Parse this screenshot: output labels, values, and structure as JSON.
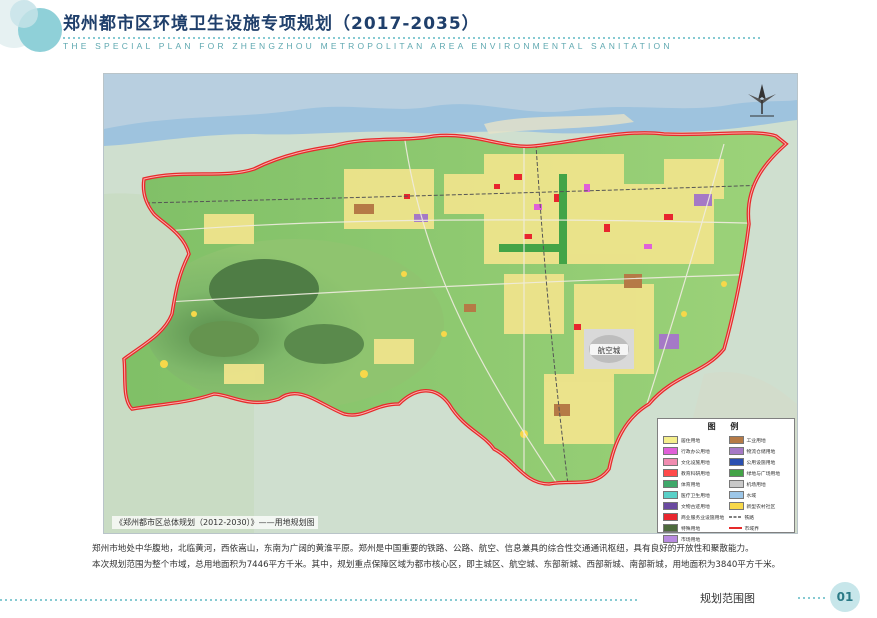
{
  "header": {
    "title": "郑州都市区环境卫生设施专项规划（2017-2035）",
    "subtitle": "THE  SPECIAL PLAN FOR ZHENGZHOU  METROPOLITAN  AREA  ENVIRONMENTAL  SANITATION",
    "accent_color": "#5fb8c4"
  },
  "map": {
    "caption": "《郑州都市区总体规划（2012-2030）》——用地规划图",
    "center_label": "航空城",
    "boundary_color": "#e62a2a",
    "river_color": "#b4d0e3",
    "base_green": "#6fb45e",
    "urban_color": "#efe48c"
  },
  "legend": {
    "title": "图 例",
    "items": [
      {
        "label": "居住用地",
        "color": "#f5ef8c"
      },
      {
        "label": "工业用地",
        "color": "#b57a46"
      },
      {
        "label": "行政办公用地",
        "color": "#e060d8"
      },
      {
        "label": "物流仓储用地",
        "color": "#a579c6"
      },
      {
        "label": "文化设施用地",
        "color": "#f08cb0"
      },
      {
        "label": "公用设施用地",
        "color": "#2a4fb0"
      },
      {
        "label": "教育科研用地",
        "color": "#ff4a4a"
      },
      {
        "label": "绿地与广场用地",
        "color": "#43a447"
      },
      {
        "label": "体育用地",
        "color": "#3fa86a"
      },
      {
        "label": "机场用地",
        "color": "#c9c9c9"
      },
      {
        "label": "医疗卫生用地",
        "color": "#5ad0c8"
      },
      {
        "label": "水域",
        "color": "#9cc6e8"
      },
      {
        "label": "文物古迹用地",
        "color": "#6a4aa0"
      },
      {
        "label": "新型农村社区",
        "color": "#f7d84a"
      },
      {
        "label": "商业服务业设施用地",
        "color": "#e8262e"
      },
      {
        "label": "铁路",
        "color": "#555555"
      },
      {
        "label": "特殊用地",
        "color": "#4d6b3d"
      },
      {
        "label": "市域界",
        "color": "#e62a2a"
      },
      {
        "label": "市场用地",
        "color": "#b88ae0"
      }
    ]
  },
  "description": {
    "paragraph_1": "郑州市地处中华腹地，北临黄河，西依嵩山，东南为广阔的黄淮平原。郑州是中国重要的铁路、公路、航空、信息兼具的综合性交通通讯枢纽，具有良好的开放性和聚散能力。",
    "paragraph_2": "本次规划范围为整个市域，总用地面积为7446平方千米。其中，规划重点保障区域为都市核心区，即主城区、航空城、东部新城、西部新城、南部新城，用地面积为3840平方千米。"
  },
  "footer": {
    "page_label": "规划范围图",
    "page_number": "01"
  }
}
